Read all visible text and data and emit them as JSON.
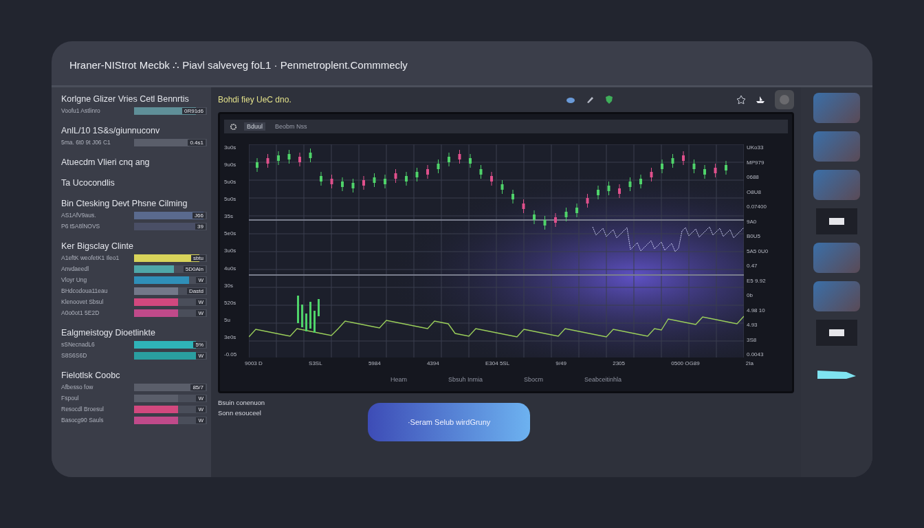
{
  "window": {
    "title": "Hraner-NIStrot Mecbk ∴ Piavl salveveg foL1 · Penmetroplent.Commmecly"
  },
  "toolbar": {
    "label": "Bohdi fiey  UeC dno."
  },
  "sidebar": [
    {
      "heading": "Korlgne Glizer Vries Cetl Bennrtis",
      "rows": [
        {
          "label": "Voofu1 Astlinro",
          "value": "0R91d6",
          "level": 0.85,
          "color": "#5f8f98"
        }
      ]
    },
    {
      "heading": "AnlL/10 1S&s/giunnuconv",
      "rows": [
        {
          "label": "5ma. 6t0  9t  J06 C1",
          "value": "0.4s1",
          "level": 0.75,
          "color": "#5a5e6a"
        }
      ]
    },
    {
      "heading": "Atuecdm Vlieri cnq ang"
    },
    {
      "heading": "Ta Ucocondlis"
    },
    {
      "heading": "Bin Ctesking Devt Phsne Cilming",
      "rows": [
        {
          "label": "AS1AfV9aus.",
          "value": "J66",
          "level": 0.95,
          "color": "#5a6a8e"
        },
        {
          "label": "P6 t5A8lNOVS",
          "value": "39",
          "level": 0.9,
          "color": "#4a4f66"
        }
      ]
    },
    {
      "heading": "Ker Bigsclay Clinte",
      "rows": [
        {
          "label": "A1eftK weofetK1 Ileo1",
          "value": "sbtu",
          "level": 0.9,
          "color": "#d8d45a"
        },
        {
          "label": "Anvdaeedl",
          "value": "5D0Aln",
          "level": 0.55,
          "color": "#4fa7a8"
        },
        {
          "label": "Vloyr Ung",
          "value": "W",
          "level": 0.75,
          "color": "#2f8fb8"
        },
        {
          "label": "BHdcodoua11eau",
          "value": "Dastd",
          "level": 0.6,
          "color": "#737889"
        },
        {
          "label": "Klenoovet Sbsul",
          "value": "W",
          "level": 0.6,
          "color": "#d2487e"
        },
        {
          "label": "A0o0ot1 5E2D",
          "value": "W",
          "level": 0.6,
          "color": "#c04a8a"
        }
      ]
    },
    {
      "heading": "Ealgmeistogy Dioetlinkte",
      "rows": [
        {
          "label": "sSNecnadL6",
          "value": "5%",
          "level": 0.85,
          "color": "#2fb3b8"
        },
        {
          "label": "S8S6S6D",
          "value": "W",
          "level": 0.85,
          "color": "#2a9ea0"
        }
      ]
    },
    {
      "heading": "Fielotlsk Coobc",
      "rows": [
        {
          "label": "Afbesso fow",
          "value": "85/7",
          "level": 0.8,
          "color": "#5a5e6a"
        },
        {
          "label": "Fspoul",
          "value": "W",
          "level": 0.6,
          "color": "#5a5e6a"
        },
        {
          "label": "Resocdl Broesul",
          "value": "W",
          "level": 0.6,
          "color": "#d2487e"
        },
        {
          "label": "Basocg90 Sauls",
          "value": "W",
          "level": 0.6,
          "color": "#c04a8a"
        }
      ]
    }
  ],
  "chart_panel": {
    "tabs": [
      {
        "label": "Bduul",
        "selected": true
      },
      {
        "label": "Beobm Nss",
        "selected": false
      }
    ],
    "y_labels": [
      "3u0s",
      "9u0s",
      "5u0s",
      "5u0s",
      "35s",
      "5e0s",
      "3u0s",
      "4u0s",
      "30s",
      "520s",
      "5u",
      "3e0s",
      "-0.05"
    ],
    "x_labels": [
      "9003 D",
      "S3SL",
      "5984",
      "4394",
      "E304 5SL",
      "9/49",
      "2305",
      "0500 OG89",
      "2Ia"
    ],
    "right_labels": [
      "UKo33",
      "MP979",
      "0688",
      "O8U8",
      "0.07400",
      "9A0",
      "B0U5",
      "5A5 0U0",
      "0.47",
      "E5  9.92",
      "0b",
      "4.98 10",
      "4.93",
      "3S8",
      "0.0043"
    ],
    "footer": [
      "Heam",
      "Sbsuh Inmia",
      "Sbocm",
      "Seabceitinhla"
    ]
  },
  "note": {
    "lines": [
      "Bsuin conenuon",
      "Sonn esouceel"
    ]
  },
  "action": {
    "label": "·Seram Selub wirdGruny"
  },
  "rail": {
    "items": [
      {
        "kind": "photo"
      },
      {
        "kind": "photo"
      },
      {
        "kind": "photo"
      },
      {
        "kind": "toggle"
      },
      {
        "kind": "photo"
      },
      {
        "kind": "photo"
      },
      {
        "kind": "toggle"
      },
      {
        "kind": "flag"
      }
    ]
  }
}
